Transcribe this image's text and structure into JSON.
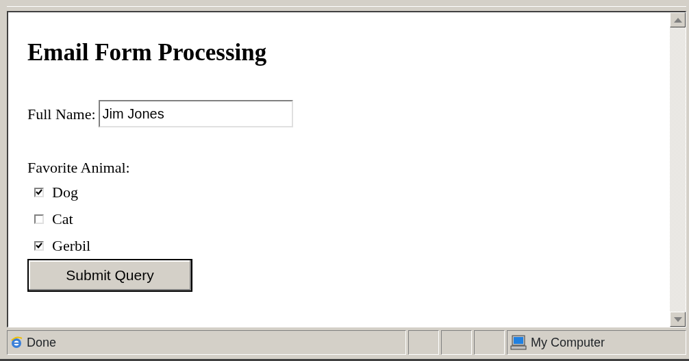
{
  "heading": "Email Form Processing",
  "name_field": {
    "label": "Full Name:",
    "value": "Jim Jones"
  },
  "animals": {
    "label": "Favorite Animal:",
    "options": [
      {
        "label": "Dog",
        "checked": true
      },
      {
        "label": "Cat",
        "checked": false
      },
      {
        "label": "Gerbil",
        "checked": true
      }
    ]
  },
  "submit_button": "Submit Query",
  "status_bar": {
    "status": "Done",
    "zone": "My Computer"
  }
}
